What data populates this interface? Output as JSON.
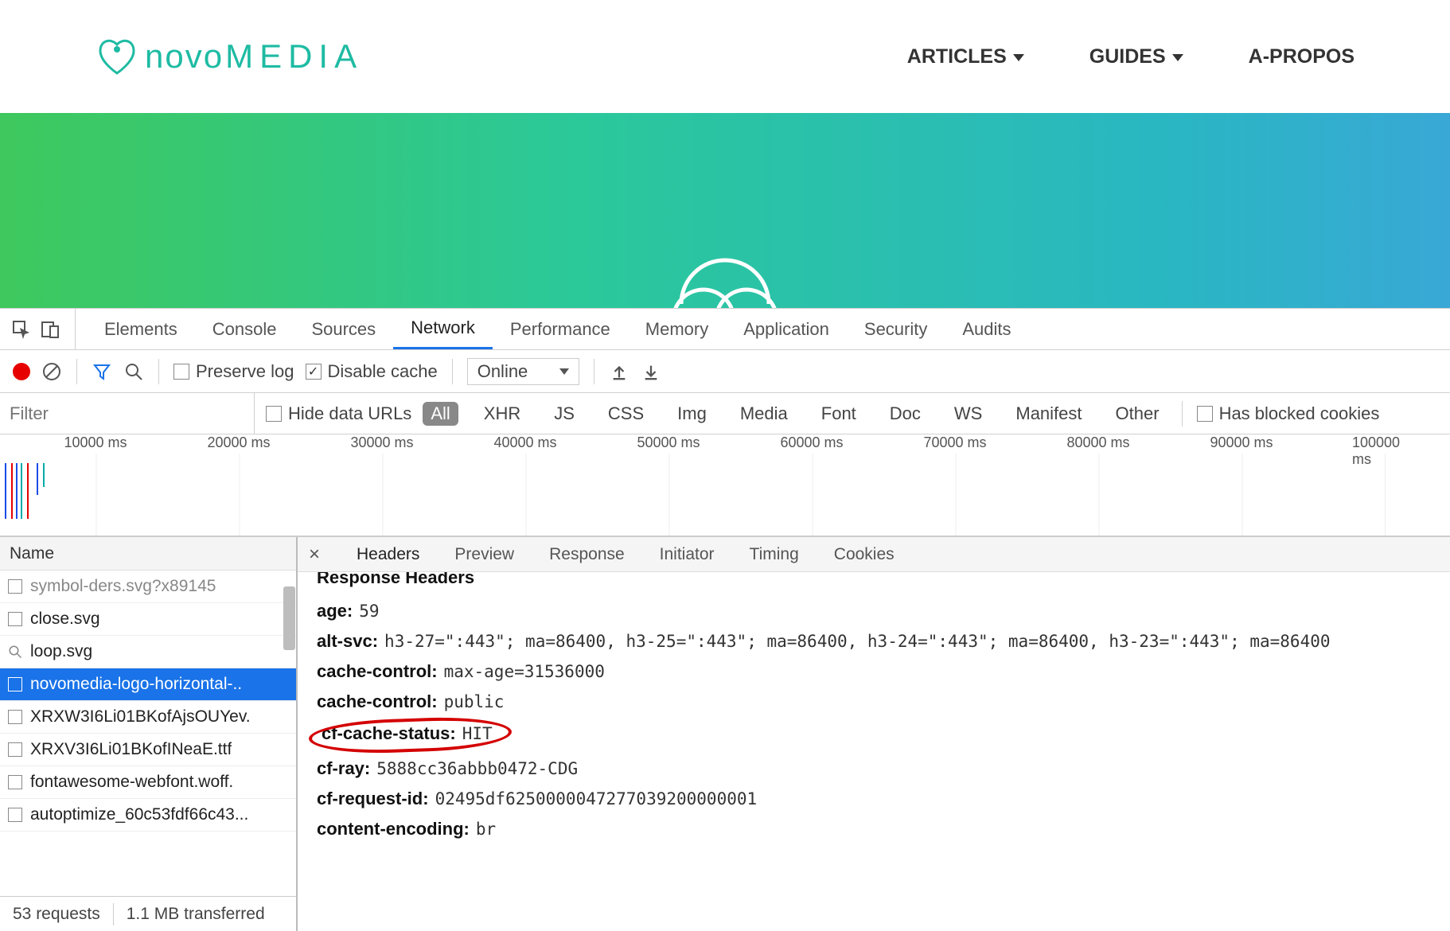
{
  "site": {
    "logo_novo": "novo",
    "logo_media": "MEDIA",
    "nav": [
      "ARTICLES",
      "GUIDES",
      "A-PROPOS"
    ]
  },
  "devtools": {
    "tabs": [
      "Elements",
      "Console",
      "Sources",
      "Network",
      "Performance",
      "Memory",
      "Application",
      "Security",
      "Audits"
    ],
    "active_tab": "Network",
    "toolbar": {
      "preserve_log": "Preserve log",
      "disable_cache": "Disable cache",
      "connection": "Online"
    },
    "filter": {
      "placeholder": "Filter",
      "hide_data_urls": "Hide data URLs",
      "types": [
        "All",
        "XHR",
        "JS",
        "CSS",
        "Img",
        "Media",
        "Font",
        "Doc",
        "WS",
        "Manifest",
        "Other"
      ],
      "blocked_cookies": "Has blocked cookies"
    },
    "waterfall_ticks": [
      "10000 ms",
      "20000 ms",
      "30000 ms",
      "40000 ms",
      "50000 ms",
      "60000 ms",
      "70000 ms",
      "80000 ms",
      "90000 ms",
      "100000 ms"
    ],
    "requests": {
      "column": "Name",
      "items": [
        {
          "name": "symbol-ders.svg?x89145",
          "icon": "doc"
        },
        {
          "name": "close.svg",
          "icon": "doc"
        },
        {
          "name": "loop.svg",
          "icon": "search"
        },
        {
          "name": "novomedia-logo-horizontal-..",
          "icon": "img",
          "selected": true
        },
        {
          "name": "XRXW3I6Li01BKofAjsOUYev.",
          "icon": "doc"
        },
        {
          "name": "XRXV3I6Li01BKofINeaE.ttf",
          "icon": "doc"
        },
        {
          "name": "fontawesome-webfont.woff.",
          "icon": "doc"
        },
        {
          "name": "autoptimize_60c53fdf66c43...",
          "icon": "doc"
        }
      ],
      "footer": {
        "requests": "53 requests",
        "transferred": "1.1 MB transferred"
      }
    },
    "detail": {
      "tabs": [
        "Headers",
        "Preview",
        "Response",
        "Initiator",
        "Timing",
        "Cookies"
      ],
      "active": "Headers",
      "section_title": "Response Headers",
      "headers": [
        {
          "name": "age:",
          "value": "59"
        },
        {
          "name": "alt-svc:",
          "value": "h3-27=\":443\"; ma=86400, h3-25=\":443\"; ma=86400, h3-24=\":443\"; ma=86400, h3-23=\":443\"; ma=86400"
        },
        {
          "name": "cache-control:",
          "value": "max-age=31536000"
        },
        {
          "name": "cache-control:",
          "value": "public"
        },
        {
          "name": "cf-cache-status:",
          "value": "HIT",
          "circled": true
        },
        {
          "name": "cf-ray:",
          "value": "5888cc36abbb0472-CDG"
        },
        {
          "name": "cf-request-id:",
          "value": "02495df6250000047277039200000001"
        },
        {
          "name": "content-encoding:",
          "value": "br"
        }
      ]
    }
  }
}
